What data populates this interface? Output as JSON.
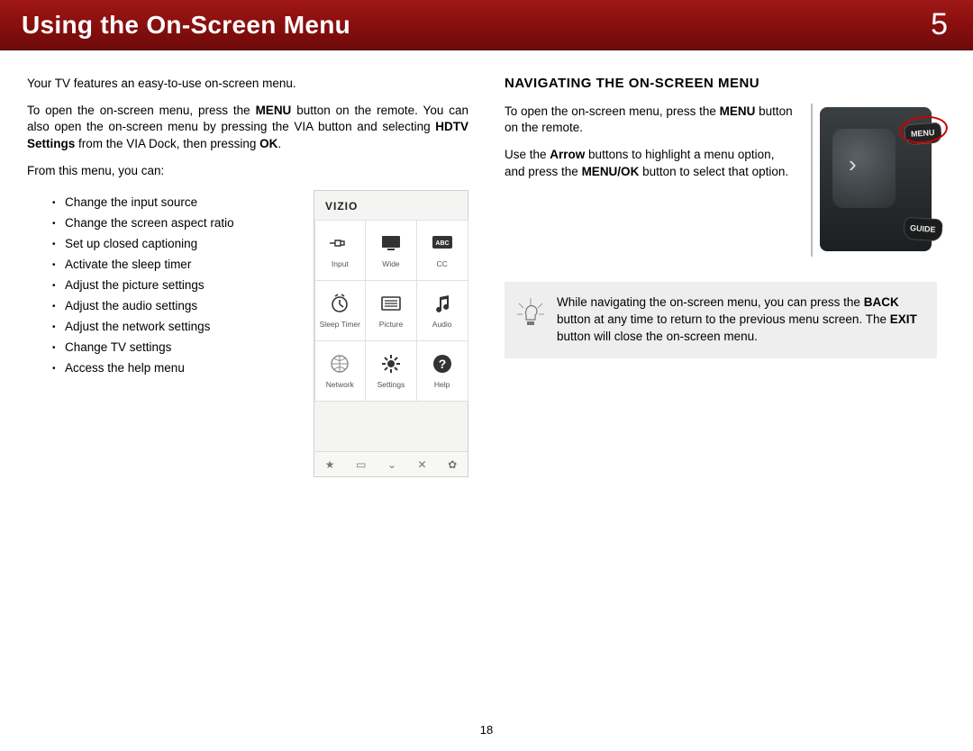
{
  "banner": {
    "title": "Using the On-Screen Menu",
    "chapter": "5"
  },
  "left": {
    "p1": "Your TV features an easy-to-use on-screen menu.",
    "p2a": "To open the on-screen menu, press the ",
    "p2b": "MENU",
    "p2c": " button on the remote. You can also open the on-screen menu by pressing the VIA button and selecting ",
    "p2d": "HDTV Settings",
    "p2e": " from the VIA Dock, then pressing ",
    "p2f": "OK",
    "p2g": ".",
    "p3": "From this menu, you can:",
    "bullets": [
      "Change the input source",
      "Change the screen aspect ratio",
      "Set up closed captioning",
      "Activate the sleep timer",
      "Adjust the picture settings",
      "Adjust the audio settings",
      "Adjust the network settings",
      "Change TV settings",
      "Access the help menu"
    ],
    "osd": {
      "logo": "VIZIO",
      "cells": [
        {
          "label": "Input"
        },
        {
          "label": "Wide"
        },
        {
          "label": "CC"
        },
        {
          "label": "Sleep Timer"
        },
        {
          "label": "Picture"
        },
        {
          "label": "Audio"
        },
        {
          "label": "Network"
        },
        {
          "label": "Settings"
        },
        {
          "label": "Help"
        }
      ]
    }
  },
  "right": {
    "heading": "NAVIGATING THE ON-SCREEN MENU",
    "p1a": "To open the on-screen menu, press the ",
    "p1b": "MENU",
    "p1c": " button on the remote.",
    "p2a": "Use the ",
    "p2b": "Arrow",
    "p2c": " buttons to highlight a menu option, and press the ",
    "p2d": "MENU/OK",
    "p2e": " button to select that option.",
    "remote": {
      "menu": "MENU",
      "guide": "GUIDE"
    },
    "tip": {
      "t1": "While navigating the on-screen menu, you can press the ",
      "t2": "BACK",
      "t3": " button at any time to return to the previous menu screen. The ",
      "t4": "EXIT",
      "t5": " button will close the on-screen menu."
    }
  },
  "page_number": "18"
}
